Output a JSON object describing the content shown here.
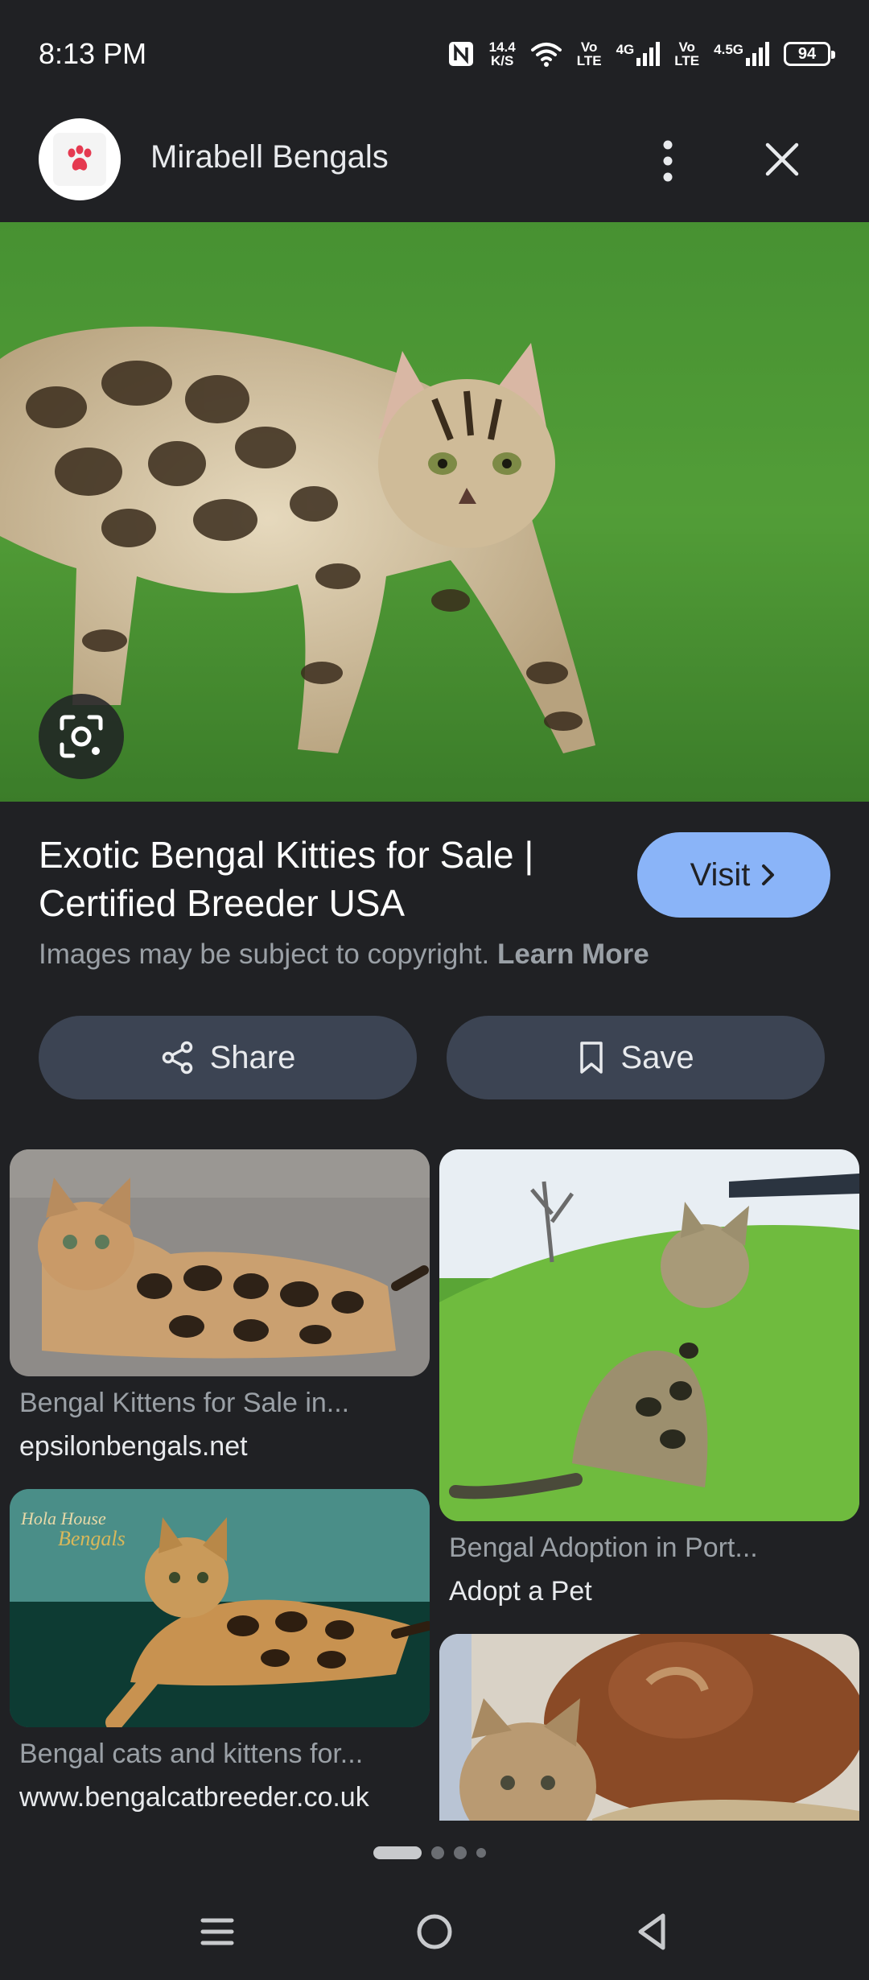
{
  "status_bar": {
    "time": "8:13 PM",
    "net_speed_value": "14.4",
    "net_speed_unit": "K/S",
    "sim1_top": "Vo",
    "sim1_bottom": "LTE",
    "sim1_network": "4G",
    "sim2_top": "Vo",
    "sim2_bottom": "LTE",
    "sim2_network": "4.5G",
    "battery": "94",
    "icons": [
      "nfc-icon",
      "wifi-icon",
      "signal-icon",
      "signal-icon",
      "battery-icon"
    ]
  },
  "header": {
    "site_name": "Mirabell Bengals",
    "icons": [
      "paw-logo-icon",
      "more-vert-icon",
      "close-icon"
    ]
  },
  "result": {
    "title": "Exotic Bengal Kitties for Sale | Certified Breeder USA",
    "visit_label": "Visit",
    "copyright_text": "Images may be subject to copyright.",
    "learn_more": "Learn More"
  },
  "actions": {
    "share_label": "Share",
    "save_label": "Save"
  },
  "related": [
    {
      "title": "Bengal Kittens for Sale in...",
      "source": "epsilonbengals.net"
    },
    {
      "title": "Bengal Adoption in Port...",
      "source": "Adopt a Pet"
    },
    {
      "title": "Bengal cats and kittens for...",
      "source": "www.bengalcatbreeder.co.uk",
      "watermark": "Hola House Bengals"
    },
    {
      "title": "",
      "source": ""
    }
  ],
  "colors": {
    "background": "#202124",
    "accent": "#8ab4f8",
    "pill": "#3c4453"
  }
}
